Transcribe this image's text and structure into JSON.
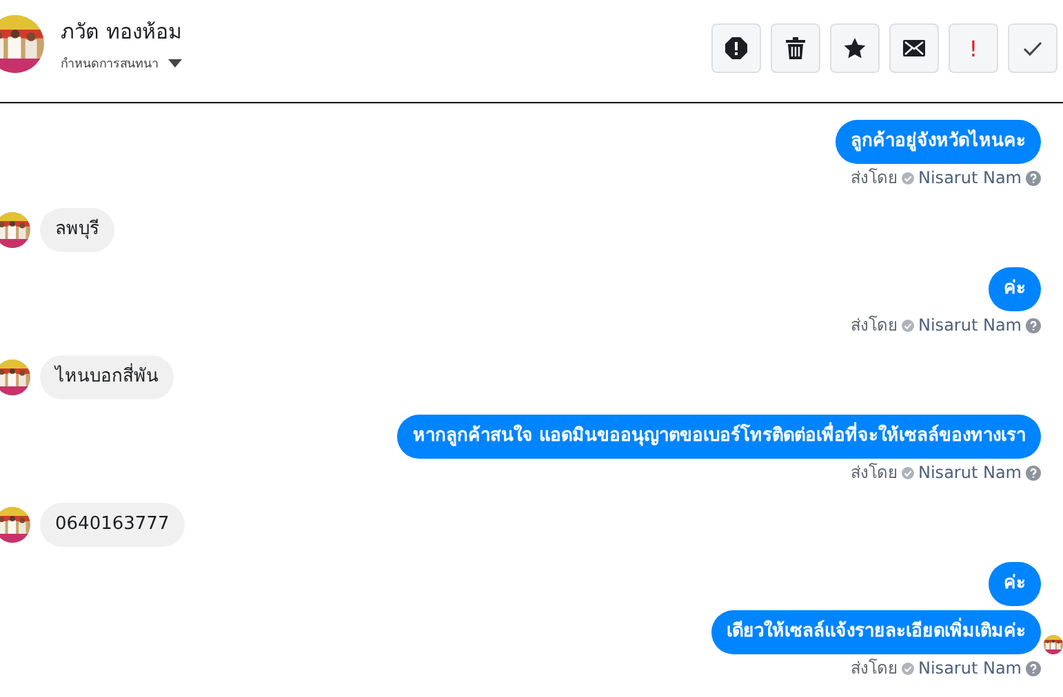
{
  "header": {
    "name": "ภวัต ทองห้อม",
    "subtitle": "กำหนดการสนทนา",
    "important_label": "!"
  },
  "messages": [
    {
      "kind": "outgoing",
      "text": "ลูกค้าอยู่จังหวัดไหนคะ"
    },
    {
      "kind": "sent_by",
      "label": "ส่งโดย",
      "name": "Nisarut Nam"
    },
    {
      "kind": "incoming",
      "text": "ลพบุรี"
    },
    {
      "kind": "outgoing",
      "text": "ค่ะ"
    },
    {
      "kind": "sent_by",
      "label": "ส่งโดย",
      "name": "Nisarut Nam"
    },
    {
      "kind": "incoming",
      "text": "ไหนบอกสี่พัน"
    },
    {
      "kind": "outgoing",
      "text": "หากลูกค้าสนใจ แอดมินขออนุญาตขอเบอร์โทรติดต่อเพื่อที่จะให้เซลล์ของทางเรา"
    },
    {
      "kind": "sent_by",
      "label": "ส่งโดย",
      "name": "Nisarut Nam"
    },
    {
      "kind": "incoming",
      "text": "0640163777"
    },
    {
      "kind": "outgoing",
      "text": "ค่ะ",
      "seen": false
    },
    {
      "kind": "outgoing",
      "text": "เดียวให้เซลล์แจ้งรายละเอียดเพิ่มเติมค่ะ",
      "seen": true
    },
    {
      "kind": "sent_by",
      "label": "ส่งโดย",
      "name": "Nisarut Nam"
    }
  ]
}
